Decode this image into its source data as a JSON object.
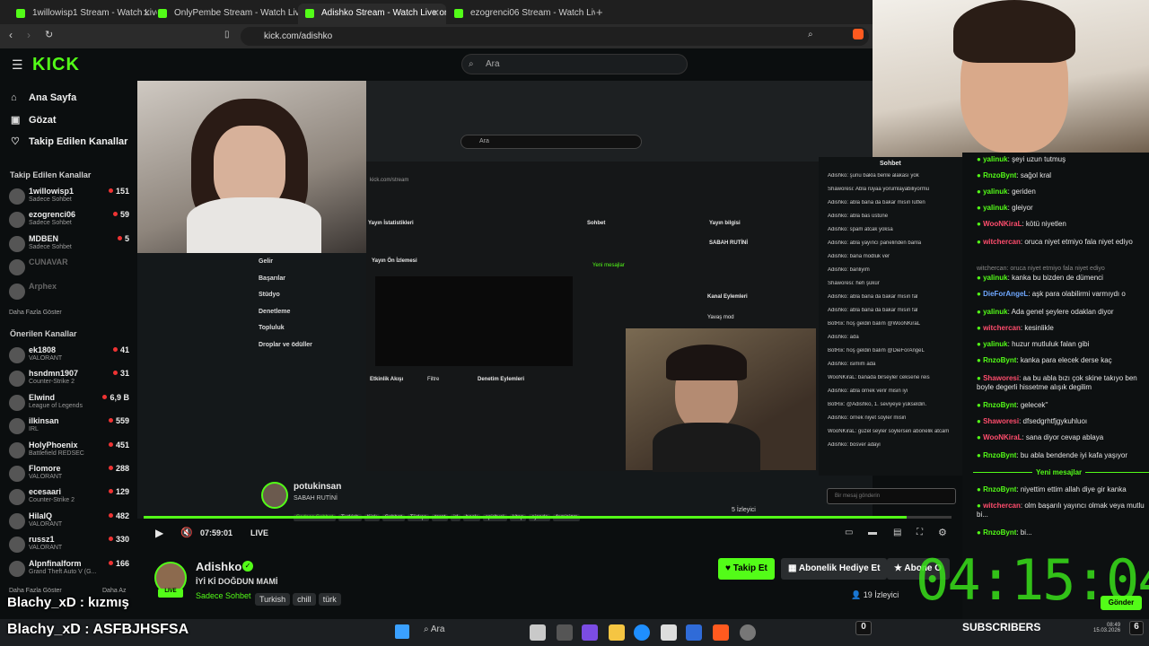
{
  "browser": {
    "tabs": [
      {
        "label": "1willowisp1 Stream - Watch Live"
      },
      {
        "label": "OnlyPembe Stream - Watch Live on"
      },
      {
        "label": "Adishko Stream - Watch Live on"
      },
      {
        "label": "ezogrenci06 Stream - Watch Live"
      }
    ],
    "url": "kick.com/adishko"
  },
  "header": {
    "logo": "KICK",
    "search_placeholder": "Ara"
  },
  "sidebar": {
    "nav": [
      {
        "label": "Ana Sayfa",
        "icon": "home-icon"
      },
      {
        "label": "Gözat",
        "icon": "browse-icon"
      },
      {
        "label": "Takip Edilen Kanallar",
        "icon": "heart-icon"
      }
    ],
    "followed_title": "Takip Edilen Kanallar",
    "followed": [
      {
        "name": "1willowisp1",
        "game": "Sadece Sohbet",
        "viewers": "151"
      },
      {
        "name": "ezogrenci06",
        "game": "Sadece Sohbet",
        "viewers": "59"
      },
      {
        "name": "MDBEN",
        "game": "Sadece Sohbet",
        "viewers": "5"
      },
      {
        "name": "CUNAVAR",
        "game": "",
        "viewers": ""
      },
      {
        "name": "Arphex",
        "game": "",
        "viewers": ""
      }
    ],
    "show_more": "Daha Fazla Göster",
    "recommended_title": "Önerilen Kanallar",
    "recommended": [
      {
        "name": "ek1808",
        "game": "VALORANT",
        "viewers": "41"
      },
      {
        "name": "hsndmn1907",
        "game": "Counter-Strike 2",
        "viewers": "31"
      },
      {
        "name": "Elwind",
        "game": "League of Legends",
        "viewers": "6,9 B"
      },
      {
        "name": "ilkinsan",
        "game": "IRL",
        "viewers": "559"
      },
      {
        "name": "HolyPhoenix",
        "game": "Battlefield REDSEC",
        "viewers": "451"
      },
      {
        "name": "Flomore",
        "game": "VALORANT",
        "viewers": "288"
      },
      {
        "name": "ecesaari",
        "game": "Counter-Strike 2",
        "viewers": "129"
      },
      {
        "name": "HilalQ",
        "game": "VALORANT",
        "viewers": "482"
      },
      {
        "name": "russz1",
        "game": "VALORANT",
        "viewers": "330"
      },
      {
        "name": "Alpnfinalform",
        "game": "Grand Theft Auto V (G...",
        "viewers": "166"
      }
    ],
    "show_more2": "Daha Fazla Göster",
    "less": "Daha Az"
  },
  "video": {
    "inner_search": "Ara",
    "inner_url": "kick.com/stream",
    "inner_labels": {
      "stats": "Yayın İstatistikleri",
      "chat": "Sohbet",
      "info": "Yayın bilgisi",
      "preview": "Yayın Ön İzlemesi",
      "actions": "Kanal Eylemleri",
      "mode": "Yavaş mod",
      "activity": "Etkinlik Akışı",
      "filter": "Filtre",
      "audit": "Denetim Eylemleri",
      "new_msgs": "Yeni mesajlar",
      "info_title": "SABAH RUTİNİ",
      "menu": [
        "Gelir",
        "Başarılar",
        "Stüdyo",
        "Denetleme",
        "Topluluk",
        "Droplar ve ödüller"
      ]
    },
    "inner_chat_title": "Sohbet",
    "inner_chat": [
      "Adishko: şunu bakla benle alakası yok",
      "Shaworesi: Abla rüyaa yorumlayabiliyormu",
      "Adishko: abla bana da bakar mısın lütfen",
      "Adishko: abla bas üstüne",
      "Adishko: spam atcak yoksa",
      "Adishko: abla yayıncı panelinden banla",
      "Adishko: bana modluk ver",
      "Adishko: banliyim",
      "Shaworesi: heh şükür",
      "Adishko: abla bana da bakar mısın fal",
      "Adishko: abla bana da bakar mısın fal",
      "BotRix: hoş geldin balım @WooNKiraL",
      "Adishko: ada",
      "BotRix: hoş geldin balım @DieForAngeL",
      "Adishko: isimim ada",
      "WooNKiraL: banada birseyler ceksene reis",
      "Adishko: abla örnek verir misin iyi",
      "BotRix: @Adishko, 1. seviyeye yükseldin.",
      "Adishko: örnek niyet söyler misin",
      "WooNKiraL: güzel seyler söylersen abonelik atcam",
      "Adishko: bosver adayi"
    ],
    "inner_streamer": "potukinsan",
    "inner_title": "SABAH RUTİNİ",
    "inner_tags": [
      "Sadece Sohbet",
      "Turkish",
      "Kick",
      "Sohbet",
      "Türkçe",
      "tarot",
      "irl",
      "book",
      "spiritual",
      "kitap",
      "ajanda",
      "feminizm"
    ],
    "inner_viewers": "5 İzleyici",
    "inner_placeholder": "Bir mesaj gönderin",
    "time": "07:59:01",
    "live": "LIVE",
    "progress": 0.944
  },
  "stream": {
    "name": "Adishko",
    "title": "İYİ Kİ DOĞDUN MAMİ",
    "category": "Sadece Sohbet",
    "tags": [
      "Turkish",
      "chill",
      "türk"
    ],
    "follow": "Takip Et",
    "subscribe": "Abonelik Hediye Et",
    "subscribe2": "Abone O",
    "viewers": "19 İzleyici"
  },
  "chat": [
    {
      "user": "yalinuk",
      "color": "#53fc18",
      "text": "şeyi uzun tutmuş"
    },
    {
      "user": "RnzoBynt",
      "color": "#53fc18",
      "text": "sağol kral"
    },
    {
      "user": "yalinuk",
      "color": "#53fc18",
      "text": "geriden"
    },
    {
      "user": "yalinuk",
      "color": "#53fc18",
      "text": "gleiyor"
    },
    {
      "user": "WooNKiraL",
      "color": "#ff4d6d",
      "text": "kötü niyetlen"
    },
    {
      "user": "witchercan",
      "color": "#ff4d6d",
      "text": "oruca niyet etmiyo fala niyet ediyo"
    },
    {
      "user": "",
      "color": "#888888",
      "text": "witchercan: oruca niyet etmiyo fala niyet ediyo"
    },
    {
      "user": "yalinuk",
      "color": "#53fc18",
      "text": "kanka bu bizden de dümenci"
    },
    {
      "user": "DieForAngeL",
      "color": "#6fa8ff",
      "text": "aşk para olabilirmi varmıydı o"
    },
    {
      "user": "yalinuk",
      "color": "#53fc18",
      "text": "Ada genel şeylere odaklan diyor"
    },
    {
      "user": "witchercan",
      "color": "#ff4d6d",
      "text": "kesinlikle"
    },
    {
      "user": "yalinuk",
      "color": "#53fc18",
      "text": "huzur mutluluk falan gibi"
    },
    {
      "user": "RnzoBynt",
      "color": "#53fc18",
      "text": "kanka para elecek derse kaç"
    },
    {
      "user": "Shaworesi",
      "color": "#ff4d6d",
      "text": "aa bu abla bızı çok skine takıyo ben boyle degerli hissetme alışık degilim"
    },
    {
      "user": "RnzoBynt",
      "color": "#53fc18",
      "text": "gelecek''"
    },
    {
      "user": "Shaworesi",
      "color": "#ff4d6d",
      "text": "dfsedgrhtfjgykuhluoı"
    },
    {
      "user": "WooNKiraL",
      "color": "#ff4d6d",
      "text": "sana diyor cevap ablaya"
    },
    {
      "user": "RnzoBynt",
      "color": "#53fc18",
      "text": "bu abla bendende iyi kafa yaşıyor"
    },
    {
      "user": "RnzoBynt",
      "color": "#53fc18",
      "text": "niyettim ettim allah diye gir kanka"
    },
    {
      "user": "witchercan",
      "color": "#ff4d6d",
      "text": "olm başarılı yayıncı olmak veya mutlu bi..."
    },
    {
      "user": "RnzoBynt",
      "color": "#53fc18",
      "text": "bi..."
    }
  ],
  "chat_new": "Yeni mesajlar",
  "chat_send": "Gönder",
  "clock": "04:15:04",
  "overlay": {
    "line1": "Blachy_xD : kızmış",
    "line2": "Blachy_xD : ASFBJHSFSA",
    "subs_count": "0",
    "subs_label": "SUBSCRIBERS",
    "subs_right": "6"
  },
  "taskbar": {
    "search": "Ara",
    "time": "08:49",
    "date": "15.03.2026"
  },
  "colors": {
    "accent": "#53fc18",
    "bg": "#0b0e0f",
    "live": "#e33333"
  }
}
